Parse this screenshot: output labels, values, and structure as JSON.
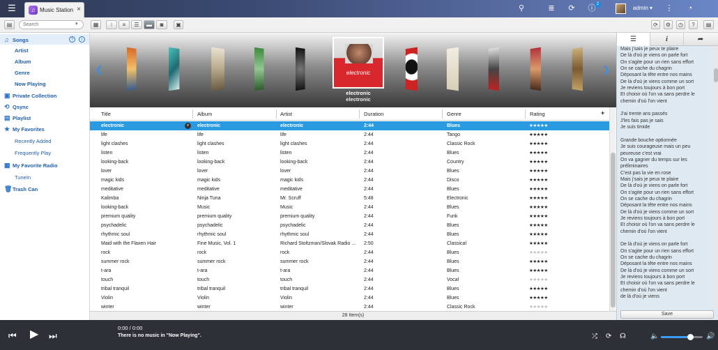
{
  "topbar": {
    "menu_icon": "hamburger-icon",
    "tab_title": "Music Station",
    "tab_close": "×",
    "notification_count": "2",
    "user": "admin ▾",
    "icons": [
      "search-icon",
      "stack-icon",
      "sync-icon",
      "info-icon",
      "user-avatar",
      "more-icon",
      "dashboard-icon"
    ]
  },
  "toolbar": {
    "search_placeholder": "Search",
    "search_arrow": "▾"
  },
  "sidebar": {
    "songs": "Songs",
    "songs_sub": [
      "Artist",
      "Album",
      "Genre",
      "Now Playing"
    ],
    "private_collection": "Private Collection",
    "qsync": "Qsync",
    "playlist": "Playlist",
    "my_favorites": "My Favorites",
    "favorites_sub": [
      "Recently Added",
      "Frequently Play"
    ],
    "my_favorite_radio": "My Favorite Radio",
    "radio_sub": [
      "TuneIn"
    ],
    "trash": "Trash Can",
    "help_q": "?",
    "help_i": "i"
  },
  "coverflow": {
    "selected_title": "electronic",
    "selected_subtitle": "electronic",
    "cover_text": "electronic",
    "prev": "❮",
    "next": "❯"
  },
  "table": {
    "columns": [
      "Title",
      "Album",
      "Artist",
      "Duration",
      "Genre",
      "Rating"
    ],
    "add_column": "+",
    "rows": [
      {
        "title": "electronic",
        "album": "electronic",
        "artist": "electronic",
        "duration": "2:44",
        "genre": "Blues",
        "rating": 5
      },
      {
        "title": "life",
        "album": "life",
        "artist": "life",
        "duration": "2:44",
        "genre": "Tango",
        "rating": 5
      },
      {
        "title": "light clashes",
        "album": "light clashes",
        "artist": "light clashes",
        "duration": "2:44",
        "genre": "Classic Rock",
        "rating": 5
      },
      {
        "title": "listen",
        "album": "listen",
        "artist": "listen",
        "duration": "2:44",
        "genre": "Blues",
        "rating": 5
      },
      {
        "title": "looking-back",
        "album": "looking-back",
        "artist": "looking-back",
        "duration": "2:44",
        "genre": "Country",
        "rating": 5
      },
      {
        "title": "lover",
        "album": "lover",
        "artist": "lover",
        "duration": "2:44",
        "genre": "Blues",
        "rating": 5
      },
      {
        "title": "magic kids",
        "album": "magic kids",
        "artist": "magic kids",
        "duration": "2:44",
        "genre": "Disco",
        "rating": 5
      },
      {
        "title": "meditative",
        "album": "meditative",
        "artist": "meditative",
        "duration": "2:44",
        "genre": "Blues",
        "rating": 5
      },
      {
        "title": "Kalimba",
        "album": "Ninja Tuna",
        "artist": "Mr. Scruff",
        "duration": "5:48",
        "genre": "Electronic",
        "rating": 5
      },
      {
        "title": "looking-back",
        "album": "Music",
        "artist": "Music",
        "duration": "2:44",
        "genre": "Blues",
        "rating": 5
      },
      {
        "title": "premium quality",
        "album": "premium quality",
        "artist": "premium quality",
        "duration": "2:44",
        "genre": "Funk",
        "rating": 5
      },
      {
        "title": "psychadelic",
        "album": "psychadelic",
        "artist": "psychadelic",
        "duration": "2:44",
        "genre": "Blues",
        "rating": 5
      },
      {
        "title": "rhythmic soul",
        "album": "rhythmic soul",
        "artist": "rhythmic soul",
        "duration": "2:44",
        "genre": "Blues",
        "rating": 5
      },
      {
        "title": "Maid with the Flaxen Hair",
        "album": "Fine Music, Vol. 1",
        "artist": "Richard Stoltzman/Slovak Radio ...",
        "duration": "2:50",
        "genre": "Classical",
        "rating": 5
      },
      {
        "title": "rock",
        "album": "rock",
        "artist": "rock",
        "duration": "2:44",
        "genre": "Blues",
        "rating": 0
      },
      {
        "title": "summer rock",
        "album": "summer rock",
        "artist": "summer rock",
        "duration": "2:44",
        "genre": "Blues",
        "rating": 5
      },
      {
        "title": "t-ara",
        "album": "t-ara",
        "artist": "t-ara",
        "duration": "2:44",
        "genre": "Blues",
        "rating": 5
      },
      {
        "title": "touch",
        "album": "touch",
        "artist": "touch",
        "duration": "2:44",
        "genre": "Vocal",
        "rating": 0
      },
      {
        "title": "tribal tranquil",
        "album": "tribal tranquil",
        "artist": "tribal tranquil",
        "duration": "2:44",
        "genre": "Blues",
        "rating": 5
      },
      {
        "title": "Violin",
        "album": "Violin",
        "artist": "Violin",
        "duration": "2:44",
        "genre": "Blues",
        "rating": 5
      },
      {
        "title": "winter",
        "album": "winter",
        "artist": "winter",
        "duration": "2:44",
        "genre": "Classic Rock",
        "rating": 0
      }
    ],
    "item_count": "28 Item(s)"
  },
  "right_panel": {
    "tabs": [
      "☰",
      "i",
      "➦"
    ],
    "lyrics": "Mais j'sais je peux te plaire\nDe là d'où je viens on parle fort\nOn s'agite pour un rien sans effort\nOn se cache du chagrin\nDéposant la tête entre nos mains\nDe là d'où je viens comme un sort\nJe reviens toujours à bon port\nEt choisir où l'on va sans perdre le chemin d'où l'on vient\n\nJ'ai trente ans passés\nJ'les fais pas je sais\nJe suis timide\n\nGrande bouche optionnée\nJe suis courageuse mais un peu peureuse c'est vrai\nOn va gagner du temps sur les préliminaires\nC'est pas la vie en rose\nMais j'sais je peux te plaire\nDe là d'où je viens on parle fort\nOn s'agite pour un rien sans effort\nOn se cache du chagrin\nDéposant la tête entre nos mains\nDe là d'où je viens comme un sort\nJe reviens toujours à bon port\nEt choisir où l'on va sans perdre le chemin d'où l'on vient\n\nDe là d'où je viens on parle fort\nOn s'agite pour un rien sans effort\nOn se cache du chagrin\nDéposant la tête entre nos mains\nDe là d'où je viens comme un sort\nJe reviens toujours à bon port\nEt choisir où l'on va sans perdre le chemin d'où l'on vient\nde là d'où je viens",
    "save": "Save"
  },
  "player": {
    "time": "0:00 / 0:00",
    "message": "There is no music in \"Now Playing\".",
    "volume_fraction": 0.7
  },
  "colors": {
    "accent": "#2a9be0",
    "sidebar_text": "#1f5fa8",
    "player_bg": "#2e3037"
  }
}
